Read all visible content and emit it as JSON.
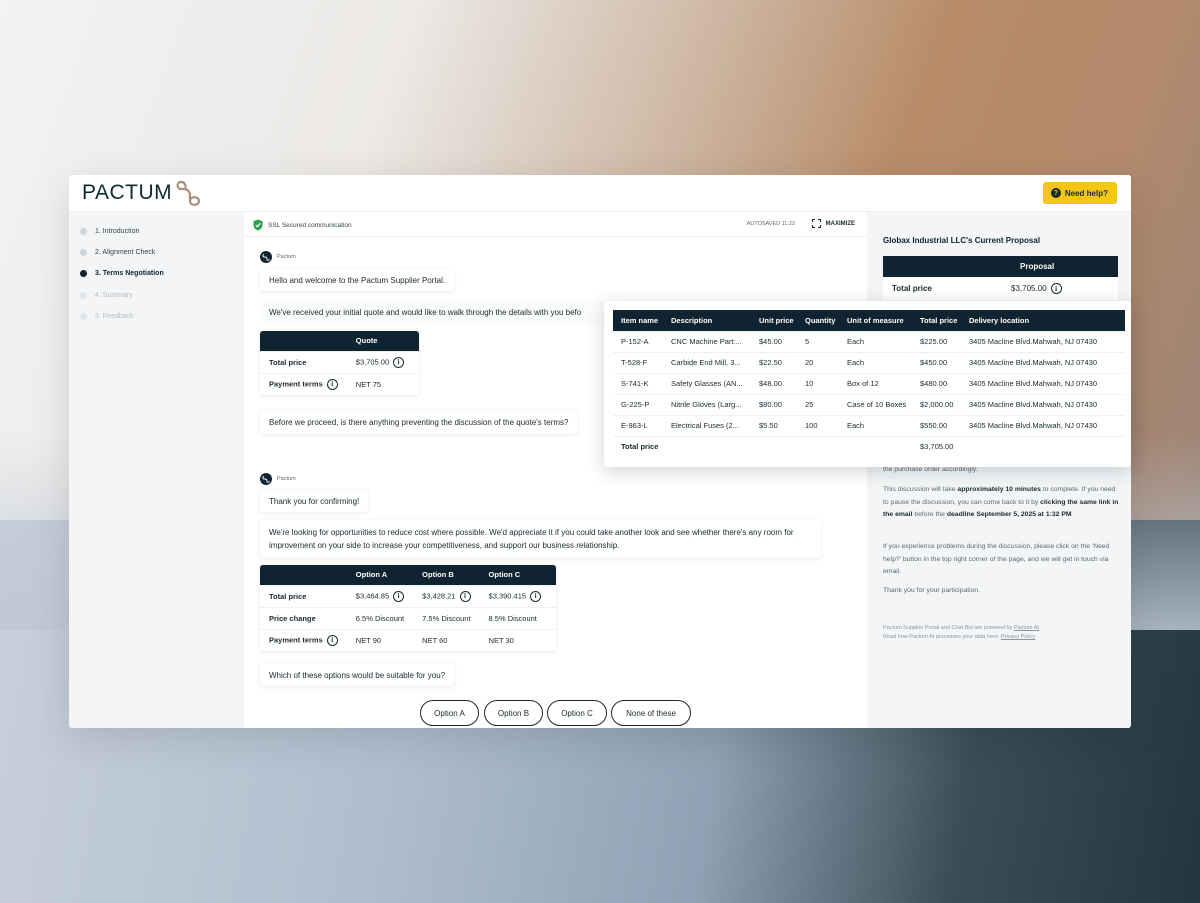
{
  "app": {
    "logo_text": "PACTUM",
    "help_label": "Need help?"
  },
  "steps": [
    {
      "label": "1. Introduction"
    },
    {
      "label": "2. Alignment Check"
    },
    {
      "label": "3. Terms Negotiation"
    },
    {
      "label": "4. Summary"
    },
    {
      "label": "5. Feedback"
    }
  ],
  "chatbar": {
    "ssl_label": "SSL Secured communication",
    "autosaved": "AUTOSAVED 11:22",
    "maximize": "MAXIMIZE"
  },
  "chat": {
    "sender": "Pactum",
    "msg1": "Hello and welcome to the Pactum Supplier Portal.",
    "msg2": "We've received your initial quote and would like to walk through the details with you befo",
    "quote": {
      "header": "Quote",
      "total_label": "Total price",
      "total_value": "$3,705.00",
      "terms_label": "Payment terms",
      "terms_value": "NET 75"
    },
    "msg3": "Before we proceed, is there anything preventing the discussion of the quote's terms?",
    "msg4": "Thank you for confirming!",
    "msg5": "We're looking for opportunities to reduce cost where possible. We'd appreciate it if you could take another look and see whether there's any room for improvement on your side to increase your competitiveness, and support our business relationship.",
    "options_table": {
      "headers": [
        "Option A",
        "Option B",
        "Option C"
      ],
      "rows": [
        {
          "label": "Total price",
          "values": [
            "$3,464.85",
            "$3,428.21",
            "$3,390.415"
          ]
        },
        {
          "label": "Price change",
          "values": [
            "6.5% Discount",
            "7.5% Discount",
            "8.5% Discount"
          ]
        },
        {
          "label": "Payment terms",
          "values": [
            "NET 90",
            "NET 60",
            "NET 30"
          ]
        }
      ]
    },
    "msg6": "Which of these options would be suitable for you?",
    "buttons": [
      "Option A",
      "Option B",
      "Option C",
      "None of these"
    ]
  },
  "right": {
    "title": "Globax Industrial LLC's Current Proposal",
    "proposal_header": "Proposal",
    "total_label": "Total price",
    "total_value": "$3,705.00",
    "partial_line": "the purchase order accordingly.",
    "p1_a": "This discussion will take ",
    "p1_b": "approximately 10 minutes",
    "p1_c": " to complete. If you need to pause the discussion, you can come back to it by ",
    "p1_d": "clicking the same link in the email",
    "p1_e": " before the ",
    "p1_f": "deadline September 5, 2025 at 1:32 PM",
    "p2": "If you experience problems during the discussion, please click on the 'Need help?' button in the top right corner of the page, and we will get in touch via email.",
    "p3": "Thank you for your participation.",
    "foot1_a": "Pactum Supplier Portal and Chat Bot are powered by ",
    "foot1_link": "Pactum AI",
    "foot2_a": "Read how Pactum AI processes your data here: ",
    "foot2_link": "Privacy Policy"
  },
  "popup": {
    "headers": [
      "Item name",
      "Description",
      "Unit price",
      "Quantity",
      "Unit of measure",
      "Total price",
      "Delivery location"
    ],
    "rows": [
      [
        "P-152-A",
        "CNC Machine Part:...",
        "$45.00",
        "5",
        "Each",
        "$225.00",
        "3405 Macline Blvd.Mahwah, NJ 07430"
      ],
      [
        "T-528-F",
        "Carbide End Mill, 3...",
        "$22.50",
        "20",
        "Each",
        "$450.00",
        "3405 Macline Blvd.Mahwah, NJ 07430"
      ],
      [
        "S-741-K",
        "Safety Glasses (AN...",
        "$48.00",
        "10",
        "Box of 12",
        "$480.00",
        "3405 Macline Blvd.Mahwah, NJ 07430"
      ],
      [
        "G-225-P",
        "Nitrile Gloves (Larg...",
        "$80.00",
        "25",
        "Case of 10 Boxes",
        "$2,000.00",
        "3405 Macline Blvd.Mahwah, NJ 07430"
      ],
      [
        "E-963-L",
        "Electrical Fuses (2...",
        "$5.50",
        "100",
        "Each",
        "$550.00",
        "3405 Macline Blvd.Mahwah, NJ 07430"
      ]
    ],
    "total_label": "Total price",
    "total_value": "$3,705.00"
  },
  "colors": {
    "navy": "#0f2430",
    "accent_yellow": "#f5c518",
    "ssl_green": "#2aa24a",
    "logo_mark": "#a88f78"
  }
}
